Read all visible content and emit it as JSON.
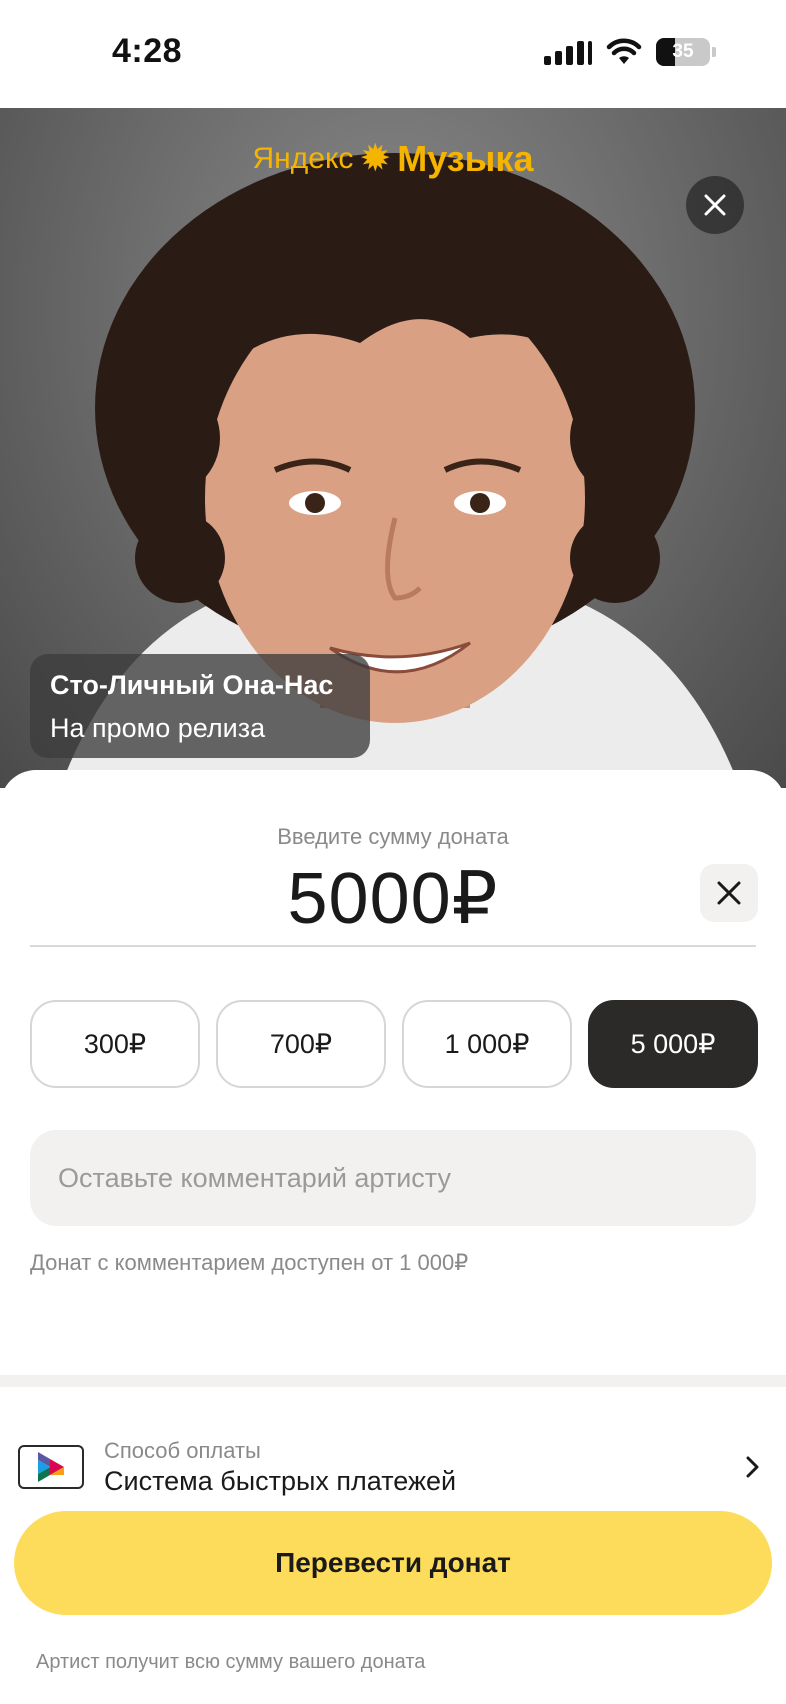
{
  "status_bar": {
    "time": "4:28",
    "battery": "35",
    "battery_level": 0.35,
    "icons": [
      "cellular-signal-icon",
      "wifi-icon",
      "battery-icon"
    ]
  },
  "hero": {
    "brand_part1": "Яндекс",
    "brand_part2": "Музыка",
    "artist_name": "Сто-Личный Она-Нас",
    "artist_subtitle": "На промо релиза"
  },
  "donation": {
    "label": "Введите сумму доната",
    "amount": "5000₽",
    "presets": [
      {
        "label": "300₽",
        "active": false
      },
      {
        "label": "700₽",
        "active": false
      },
      {
        "label": "1 000₽",
        "active": false
      },
      {
        "label": "5 000₽",
        "active": true
      }
    ],
    "comment_placeholder": "Оставьте комментарий артисту",
    "comment_note": "Донат с комментарием доступен от 1 000₽"
  },
  "payment": {
    "label": "Способ оплаты",
    "method": "Система быстрых платежей",
    "button": "Перевести донат",
    "footer": "Артист получит всю сумму вашего доната"
  },
  "colors": {
    "accent": "#fddc5c",
    "brand": "#f5b400",
    "chip_active": "#2b2a28",
    "input_bg": "#f2f1ef"
  }
}
